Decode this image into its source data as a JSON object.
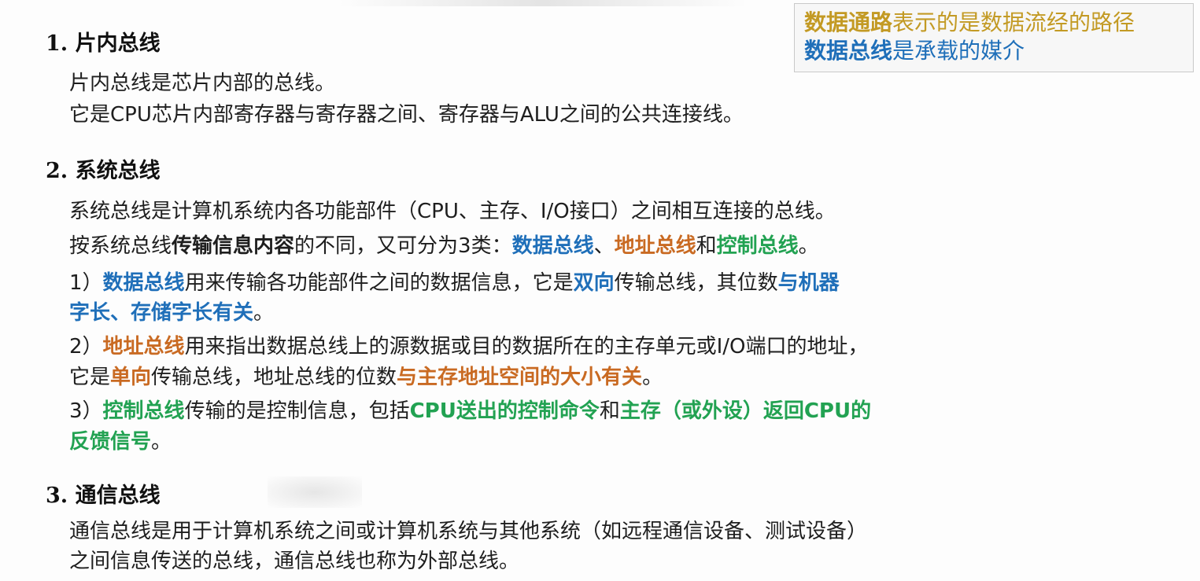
{
  "note": {
    "line1": {
      "hl": "数据通路",
      "rest": "表示的是数据流经的路径"
    },
    "line2": {
      "hl": "数据总线",
      "rest": "是承载的媒介"
    }
  },
  "sections": {
    "s1": {
      "heading": "1. 片内总线",
      "p1": "片内总线是芯片内部的总线。",
      "p2": "它是CPU芯片内部寄存器与寄存器之间、寄存器与ALU之间的公共连接线。"
    },
    "s2": {
      "heading": "2. 系统总线",
      "p1": "系统总线是计算机系统内各功能部件（CPU、主存、I/O接口）之间相互连接的总线。",
      "p2": {
        "a": "按系统总线",
        "b": "传输信息内容",
        "c": "的不同，又可分为3类：",
        "d": "数据总线",
        "e": "、",
        "f": "地址总线",
        "g": "和",
        "h": "控制总线",
        "i": "。"
      },
      "item1": {
        "a": "1）",
        "b": "数据总线",
        "c": "用来传输各功能部件之间的数据信息，它是",
        "d": "双向",
        "e": "传输总线，其位数",
        "f": "与机器",
        "g": "字长、存储字长有关",
        "h": "。"
      },
      "item2": {
        "a": "2）",
        "b": "地址总线",
        "c": "用来指出数据总线上的源数据或目的数据所在的主存单元或I/O端口的地址，",
        "d": "它是",
        "e": "单向",
        "f": "传输总线，地址总线的位数",
        "g": "与主存地址空间的大小有关",
        "h": "。"
      },
      "item3": {
        "a": "3）",
        "b": "控制总线",
        "c": "传输的是控制信息，包括",
        "d": "CPU送出的控制命令",
        "e": "和",
        "f": "主存（或外设）返回CPU的",
        "g": "反馈信号",
        "h": "。"
      }
    },
    "s3": {
      "heading": "3. 通信总线",
      "p1": "通信总线是用于计算机系统之间或计算机系统与其他系统（如远程通信设备、测试设备）",
      "p2": "之间信息传送的总线，通信总线也称为外部总线。"
    }
  }
}
